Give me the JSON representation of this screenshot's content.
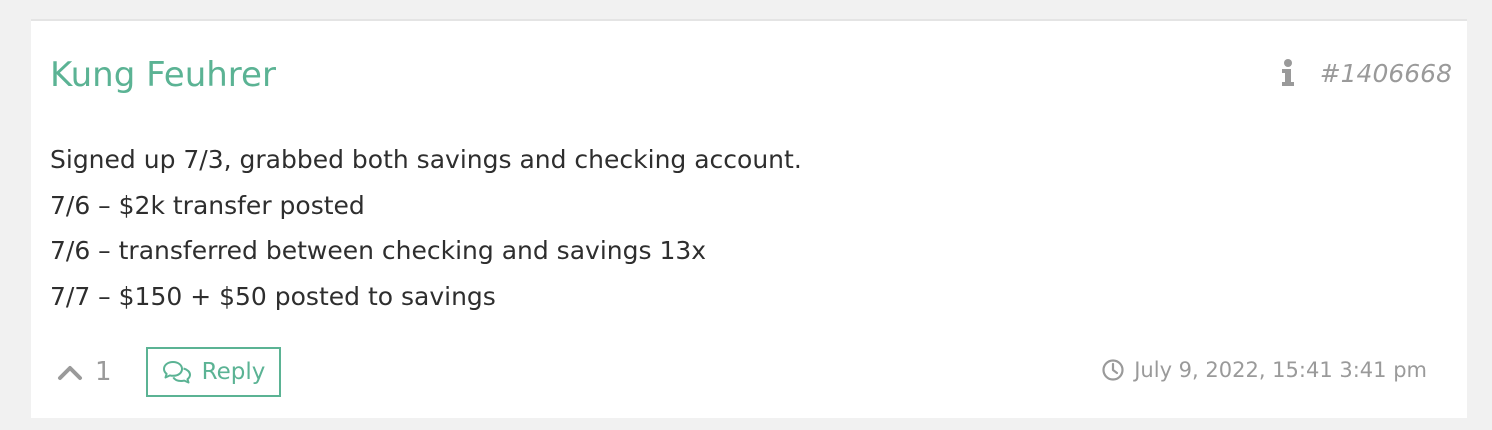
{
  "comment": {
    "author": "Kung Feuhrer",
    "id": "#1406668",
    "body_lines": [
      "Signed up 7/3, grabbed both savings and checking account.",
      "7/6 – $2k transfer posted",
      "7/6 – transferred between checking and savings 13x",
      "7/7 – $150 + $50 posted to savings"
    ],
    "vote_count": "1",
    "reply_label": "Reply",
    "timestamp": "July 9, 2022, 15:41 3:41 pm"
  },
  "icons": {
    "info": "info-icon",
    "upvote": "chevron-up-icon",
    "reply": "speech-bubbles-icon",
    "clock": "clock-icon"
  },
  "colors": {
    "accent": "#5bb394",
    "muted": "#9a9a9a",
    "text": "#2e2e2e",
    "background": "#f1f1f1",
    "card": "#ffffff"
  }
}
